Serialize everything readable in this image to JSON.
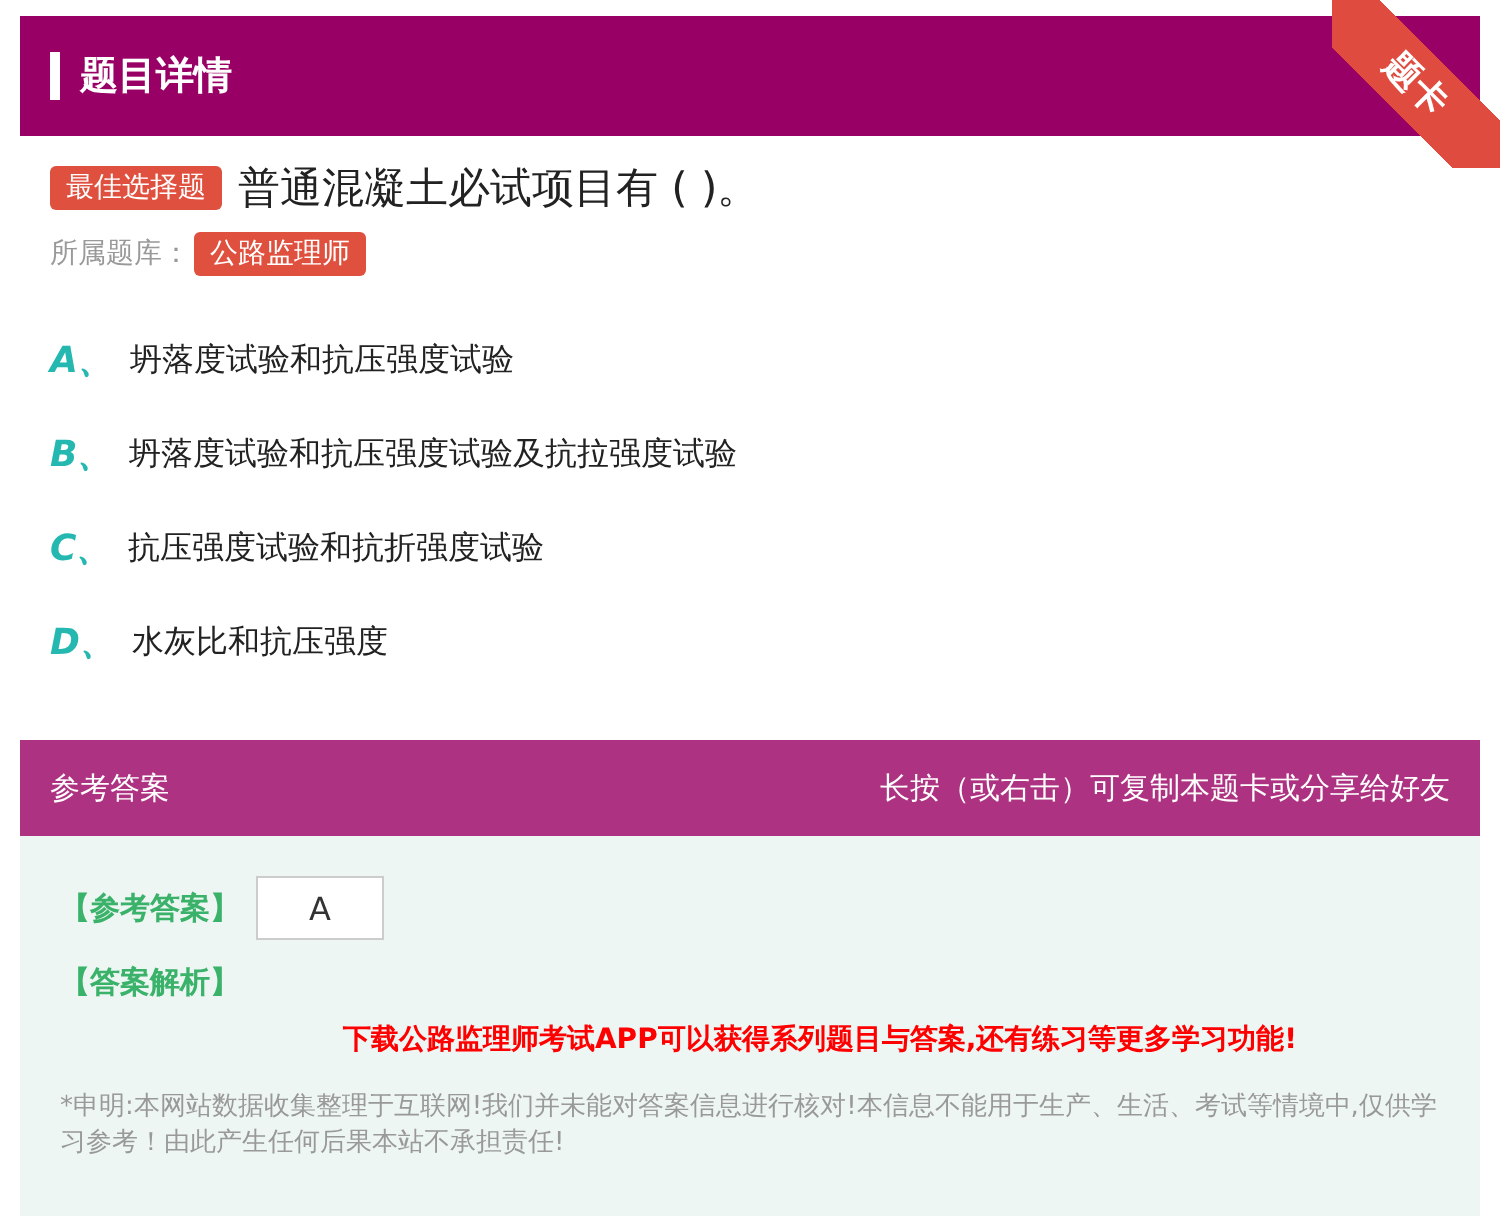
{
  "header": {
    "title": "题目详情",
    "ribbon": "题卡"
  },
  "question": {
    "type_badge": "最佳选择题",
    "text": "普通混凝土必试项目有 ( )。",
    "bank_label": "所属题库：",
    "bank": "公路监理师"
  },
  "options": [
    {
      "letter": "A、",
      "text": "坍落度试验和抗压强度试验"
    },
    {
      "letter": "B、",
      "text": "坍落度试验和抗压强度试验及抗拉强度试验"
    },
    {
      "letter": "C、",
      "text": "抗压强度试验和抗折强度试验"
    },
    {
      "letter": "D、",
      "text": "水灰比和抗压强度"
    }
  ],
  "answer_bar": {
    "title": "参考答案",
    "hint": "长按（或右击）可复制本题卡或分享给好友"
  },
  "answer": {
    "label": "【参考答案】",
    "value": "A",
    "analysis_label": "【答案解析】",
    "promo": "下载公路监理师考试APP可以获得系列题目与答案,还有练习等更多学习功能!",
    "disclaimer": "*申明:本网站数据收集整理于互联网!我们并未能对答案信息进行核对!本信息不能用于生产、生活、考试等情境中,仅供学习参考！由此产生任何后果本站不承担责任!"
  }
}
